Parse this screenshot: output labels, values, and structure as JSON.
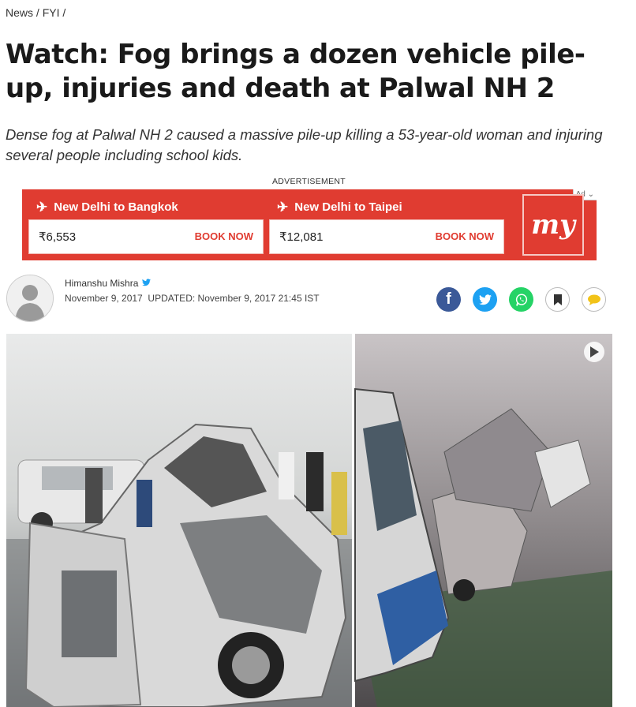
{
  "breadcrumb": {
    "section": "News",
    "sep1": "/",
    "subsection": "FYI",
    "sep2": "/"
  },
  "headline": "Watch: Fog brings a dozen vehicle pile-up, injuries and death at Palwal NH 2",
  "summary": "Dense fog at Palwal NH 2 caused a massive pile-up killing a 53-year-old woman and injuring several people including school kids.",
  "ad": {
    "label": "ADVERTISEMENT",
    "choice": "Ad",
    "logo_text": "my",
    "fares": [
      {
        "route": "New Delhi to Bangkok",
        "price": "₹6,553",
        "cta": "BOOK NOW"
      },
      {
        "route": "New Delhi to Taipei",
        "price": "₹12,081",
        "cta": "BOOK NOW"
      }
    ],
    "colors": {
      "brand": "#e03c31"
    }
  },
  "author": {
    "name": "Himanshu Mishra",
    "published": "November 9, 2017",
    "updated": "UPDATED: November 9, 2017 21:45 IST"
  },
  "share": {
    "icons": [
      "facebook-icon",
      "twitter-icon",
      "whatsapp-icon",
      "bookmark-icon",
      "comment-icon"
    ]
  },
  "media": {
    "icons": [
      "play-icon"
    ]
  }
}
